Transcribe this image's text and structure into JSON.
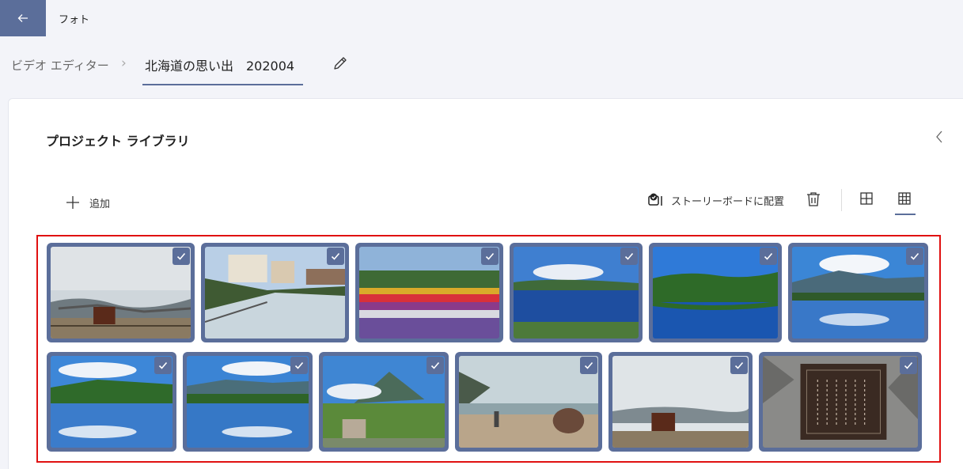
{
  "app": {
    "title": "フォト"
  },
  "breadcrumb": {
    "root": "ビデオ エディター",
    "separator": "›",
    "current": "北海道の思い出　202004"
  },
  "library": {
    "title": "プロジェクト ライブラリ"
  },
  "toolbar": {
    "add_label": "追加",
    "storyboard_label": "ストーリーボードに配置"
  },
  "media_items": [
    {
      "scene": "foggy-coast-sign",
      "selected": true
    },
    {
      "scene": "canal-town",
      "selected": true
    },
    {
      "scene": "flower-fields",
      "selected": true
    },
    {
      "scene": "lake-blue-sky",
      "selected": true
    },
    {
      "scene": "lake-forest",
      "selected": true
    },
    {
      "scene": "lake-mountain-clouds",
      "selected": true
    },
    {
      "scene": "lake-reflection",
      "selected": true
    },
    {
      "scene": "lake-reflection-2",
      "selected": true
    },
    {
      "scene": "mountain-monument",
      "selected": true
    },
    {
      "scene": "cape-monument",
      "selected": true
    },
    {
      "scene": "foggy-coast-sign-2",
      "selected": true
    },
    {
      "scene": "stone-inscription",
      "selected": true
    }
  ],
  "colors": {
    "accent": "#5b6e9a",
    "selection_frame": "#e01010",
    "background": "#f3f4f9"
  }
}
